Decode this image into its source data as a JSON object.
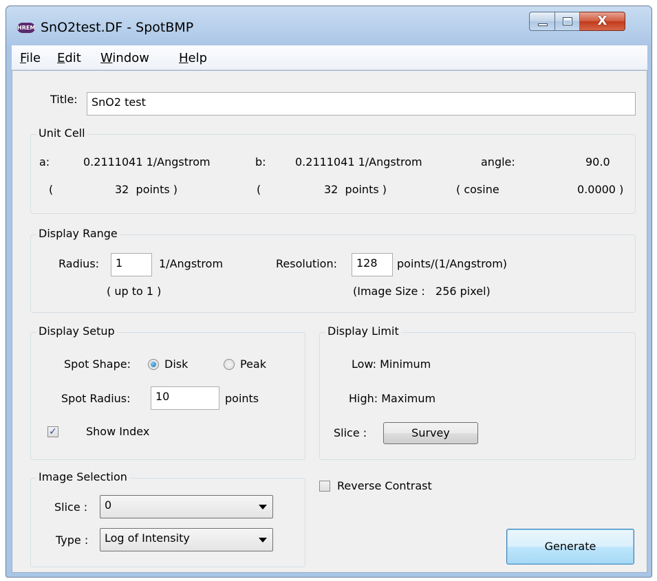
{
  "window": {
    "title": "SnO2test.DF - SpotBMP",
    "app_icon_text": "HREM",
    "close_glyph": "X"
  },
  "menu": [
    {
      "first": "F",
      "rest": "ile"
    },
    {
      "first": "E",
      "rest": "dit"
    },
    {
      "first": "W",
      "rest": "indow"
    },
    {
      "first": "H",
      "rest": "elp"
    }
  ],
  "title_field": {
    "label": "Title:",
    "value": "SnO2 test"
  },
  "unit_cell": {
    "group_title": "Unit Cell",
    "a_label": "a:",
    "a_value": "0.2111041 1/Angstrom",
    "b_label": "b:",
    "b_value": "0.2111041 1/Angstrom",
    "angle_label": "angle:",
    "angle_value": "90.0",
    "a_open": "(",
    "a_points": "32  points )",
    "b_open": "(",
    "b_points": "32  points )",
    "cosine_label": "( cosine",
    "cosine_value": "0.0000 )"
  },
  "display_range": {
    "group_title": "Display Range",
    "radius_label": "Radius:",
    "radius_value": "1",
    "radius_unit": "1/Angstrom",
    "radius_note": "( up to 1 )",
    "resolution_label": "Resolution:",
    "resolution_value": "128",
    "resolution_unit": "points/(1/Angstrom)",
    "image_size_note": "(Image Size :   256 pixel)"
  },
  "display_setup": {
    "group_title": "Display Setup",
    "spot_shape_label": "Spot Shape:",
    "disk_label": "Disk",
    "peak_label": "Peak",
    "spot_shape_selected": "Disk",
    "spot_radius_label": "Spot Radius:",
    "spot_radius_value": "10",
    "spot_radius_unit": "points",
    "show_index_label": "Show Index",
    "show_index_checked": true,
    "check_glyph": "✓"
  },
  "display_limit": {
    "group_title": "Display Limit",
    "low_text": "Low: Minimum",
    "high_text": "High: Maximum",
    "slice_label": "Slice :",
    "survey_button": "Survey"
  },
  "image_selection": {
    "group_title": "Image Selection",
    "slice_label": "Slice :",
    "slice_value": "0",
    "type_label": "Type :",
    "type_value": "Log of Intensity"
  },
  "reverse_contrast": {
    "label": "Reverse Contrast",
    "checked": false
  },
  "generate_button": "Generate"
}
